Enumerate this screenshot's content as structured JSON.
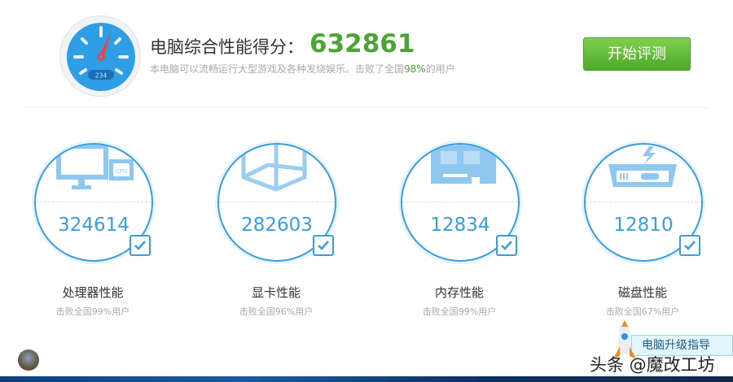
{
  "header": {
    "title": "电脑综合性能得分：",
    "score": "632861",
    "desc_prefix": "本电脑可以流畅运行大型游戏及各种发烧娱乐。击败了全国",
    "desc_pct": "98%",
    "desc_suffix": "的用户",
    "gauge_reading": "234",
    "start_button": "开始评测"
  },
  "cards": [
    {
      "score": "324614",
      "label": "处理器性能",
      "sub": "击败全国99%用户",
      "icon": "cpu-monitor-icon",
      "chip": "CPU"
    },
    {
      "score": "282603",
      "label": "显卡性能",
      "sub": "击败全国96%用户",
      "icon": "graphics-cube-icon"
    },
    {
      "score": "12834",
      "label": "内存性能",
      "sub": "击败全国99%用户",
      "icon": "memory-module-icon"
    },
    {
      "score": "12810",
      "label": "磁盘性能",
      "sub": "击败全国67%用户",
      "icon": "disk-drive-icon"
    }
  ],
  "footer": {
    "upgrade_guide": "电脑升级指导",
    "watermark": "头条 @魔改工坊"
  },
  "colors": {
    "accent": "#3a9de0",
    "score_green": "#4aa534",
    "button_green": "#5cb936"
  }
}
